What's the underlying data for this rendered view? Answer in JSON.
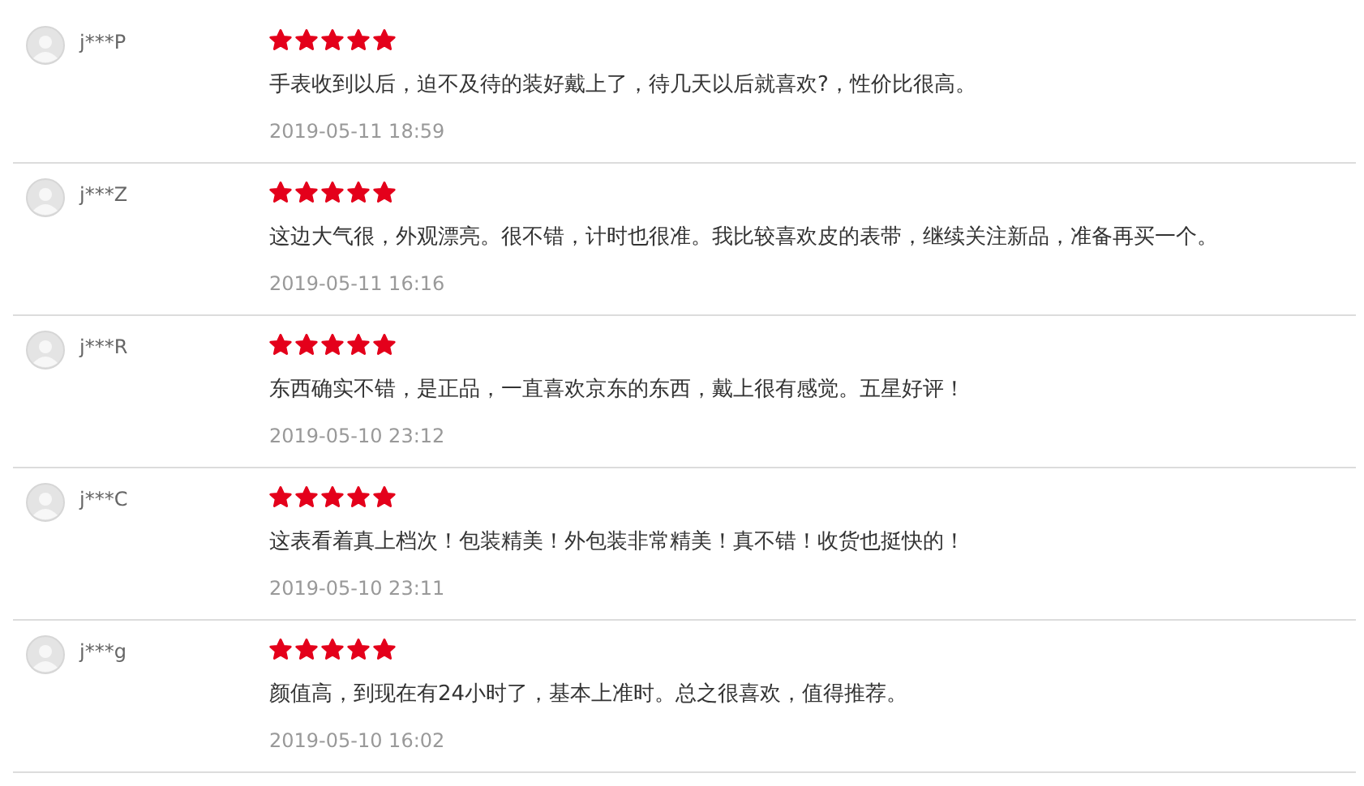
{
  "reviews": [
    {
      "user": "j***P",
      "stars": 5,
      "text": "手表收到以后，迫不及待的装好戴上了，待几天以后就喜欢?，性价比很高。",
      "date": "2019-05-11 18:59"
    },
    {
      "user": "j***Z",
      "stars": 5,
      "text": "这边大气很，外观漂亮。很不错，计时也很准。我比较喜欢皮的表带，继续关注新品，准备再买一个。",
      "date": "2019-05-11 16:16"
    },
    {
      "user": "j***R",
      "stars": 5,
      "text": "东西确实不错，是正品，一直喜欢京东的东西，戴上很有感觉。五星好评！",
      "date": "2019-05-10 23:12"
    },
    {
      "user": "j***C",
      "stars": 5,
      "text": "这表看着真上档次！包装精美！外包装非常精美！真不错！收货也挺快的！",
      "date": "2019-05-10 23:11"
    },
    {
      "user": "j***g",
      "stars": 5,
      "text": "颜值高，到现在有24小时了，基本上准时。总之很喜欢，值得推荐。",
      "date": "2019-05-10 16:02"
    }
  ]
}
